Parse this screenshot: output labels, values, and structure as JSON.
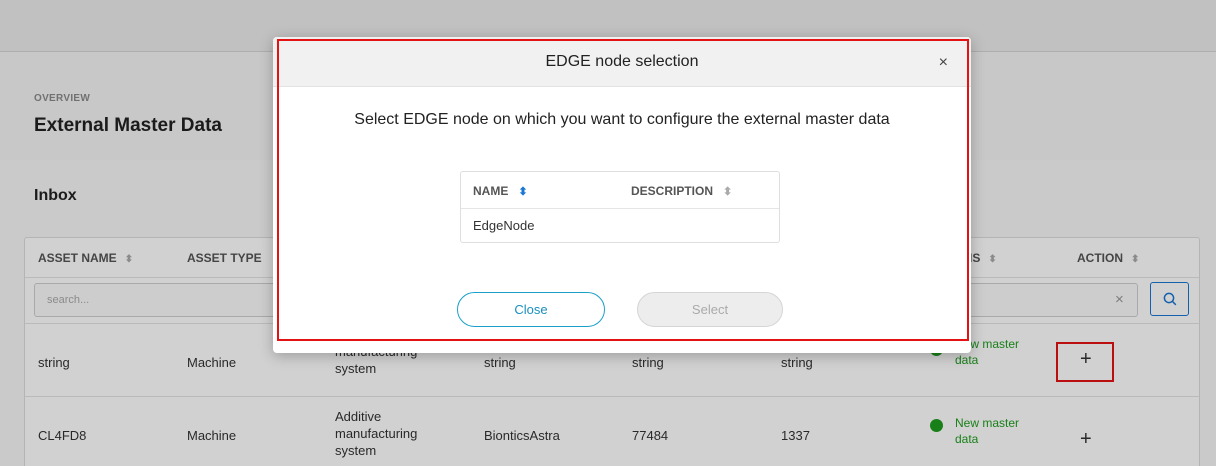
{
  "page": {
    "eyebrow": "OVERVIEW",
    "title": "External Master Data",
    "section_title": "Inbox"
  },
  "table": {
    "columns": [
      "ASSET NAME",
      "ASSET TYPE",
      "IS",
      "ACTION"
    ],
    "sort_glyph": "⬍",
    "search_placeholder": "search...",
    "rows": [
      {
        "asset_name": "string",
        "asset_type": "Machine",
        "category": "manufacturing system",
        "manufacturer": "string",
        "c5": "string",
        "c6": "string",
        "status": "New master data",
        "action": "+"
      },
      {
        "asset_name": "CL4FD8",
        "asset_type": "Machine",
        "category": "Additive manufacturing system",
        "manufacturer": "BionticsAstra",
        "c5": "77484",
        "c6": "1337",
        "status": "New master data",
        "action": "+"
      }
    ],
    "status_color": "#1f9d1f"
  },
  "modal": {
    "title": "EDGE node selection",
    "close_glyph": "×",
    "subtitle": "Select EDGE node on which you want to configure the external master data",
    "columns": [
      "NAME",
      "DESCRIPTION"
    ],
    "rows": [
      {
        "name": "EdgeNode",
        "description": ""
      }
    ],
    "close_label": "Close",
    "select_label": "Select"
  },
  "colors": {
    "accent": "#1976d2",
    "highlight": "#e41313",
    "status_green": "#1f9d1f"
  }
}
